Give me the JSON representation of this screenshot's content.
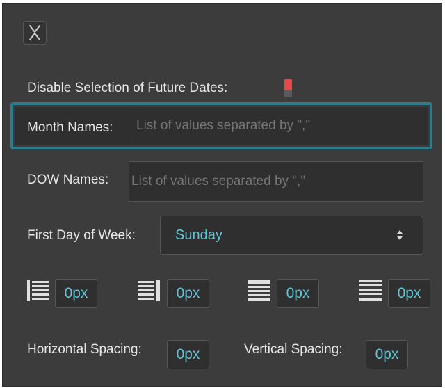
{
  "close_button": {
    "icon": "close-icon"
  },
  "disable_future": {
    "label": "Disable Selection of Future Dates:",
    "toggle_state": "on",
    "toggle_color": "#e34b4b"
  },
  "month_names": {
    "label": "Month Names:",
    "placeholder": "List of values separated by \",\""
  },
  "dow_names": {
    "label": "DOW Names:",
    "placeholder": "List of values separated by \",\""
  },
  "first_day": {
    "label": "First Day of Week:",
    "selected": "Sunday"
  },
  "alignment": [
    {
      "icon": "align-left-icon",
      "value": "0px"
    },
    {
      "icon": "align-right-icon",
      "value": "0px"
    },
    {
      "icon": "align-center-icon",
      "value": "0px"
    },
    {
      "icon": "align-justify-icon",
      "value": "0px"
    }
  ],
  "spacing": {
    "horizontal_label": "Horizontal Spacing:",
    "horizontal_value": "0px",
    "vertical_label": "Vertical Spacing:",
    "vertical_value": "0px"
  },
  "colors": {
    "accent": "#5fc4d8",
    "focus": "#2b7c8c",
    "panel": "#3c3c3c"
  }
}
